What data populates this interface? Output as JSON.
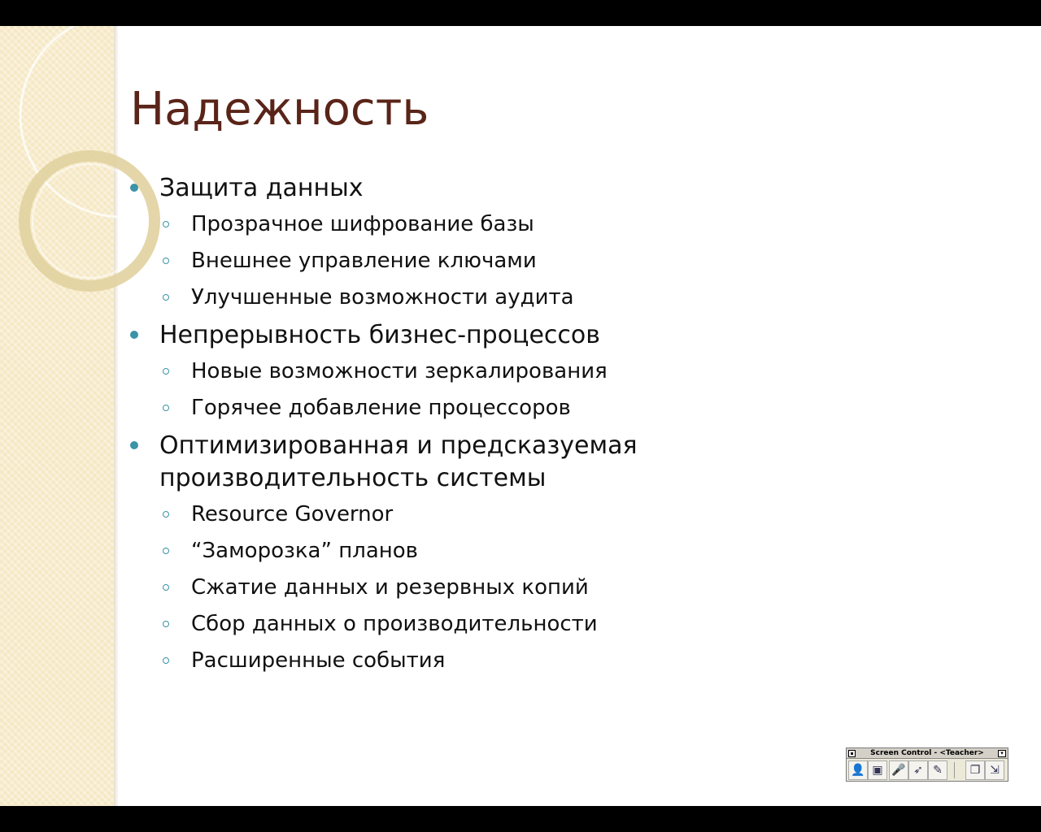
{
  "slide": {
    "title": "Надежность",
    "bullets": [
      {
        "text": "Защита данных",
        "sub": [
          "Прозрачное шифрование базы",
          "Внешнее управление ключами",
          "Улучшенные возможности аудита"
        ]
      },
      {
        "text": "Непрерывность бизнес-процессов",
        "sub": [
          "Новые возможности зеркалирования",
          "Горячее добавление процессоров"
        ]
      },
      {
        "text": "Оптимизированная и предсказуемая производительность системы",
        "sub": [
          "Resource Governor",
          "“Заморозка” планов",
          "Сжатие данных и резервных копий",
          "Сбор данных о производительности",
          "Расширенные события"
        ]
      }
    ],
    "colors": {
      "title": "#5a2418",
      "bullet": "#3b93a6",
      "side_panel": "#f6e8c4"
    }
  },
  "screen_control": {
    "title": "Screen Control - <Teacher>",
    "buttons": [
      {
        "name": "user-icon",
        "glyph": "👤"
      },
      {
        "name": "monitor-icon",
        "glyph": "▣"
      },
      {
        "name": "microphone-icon",
        "glyph": "🎤"
      },
      {
        "name": "pointer-icon",
        "glyph": "➶"
      },
      {
        "name": "pen-icon",
        "glyph": "✎"
      },
      {
        "name": "screens-icon",
        "glyph": "❐"
      },
      {
        "name": "exit-icon",
        "glyph": "⇲"
      }
    ]
  }
}
